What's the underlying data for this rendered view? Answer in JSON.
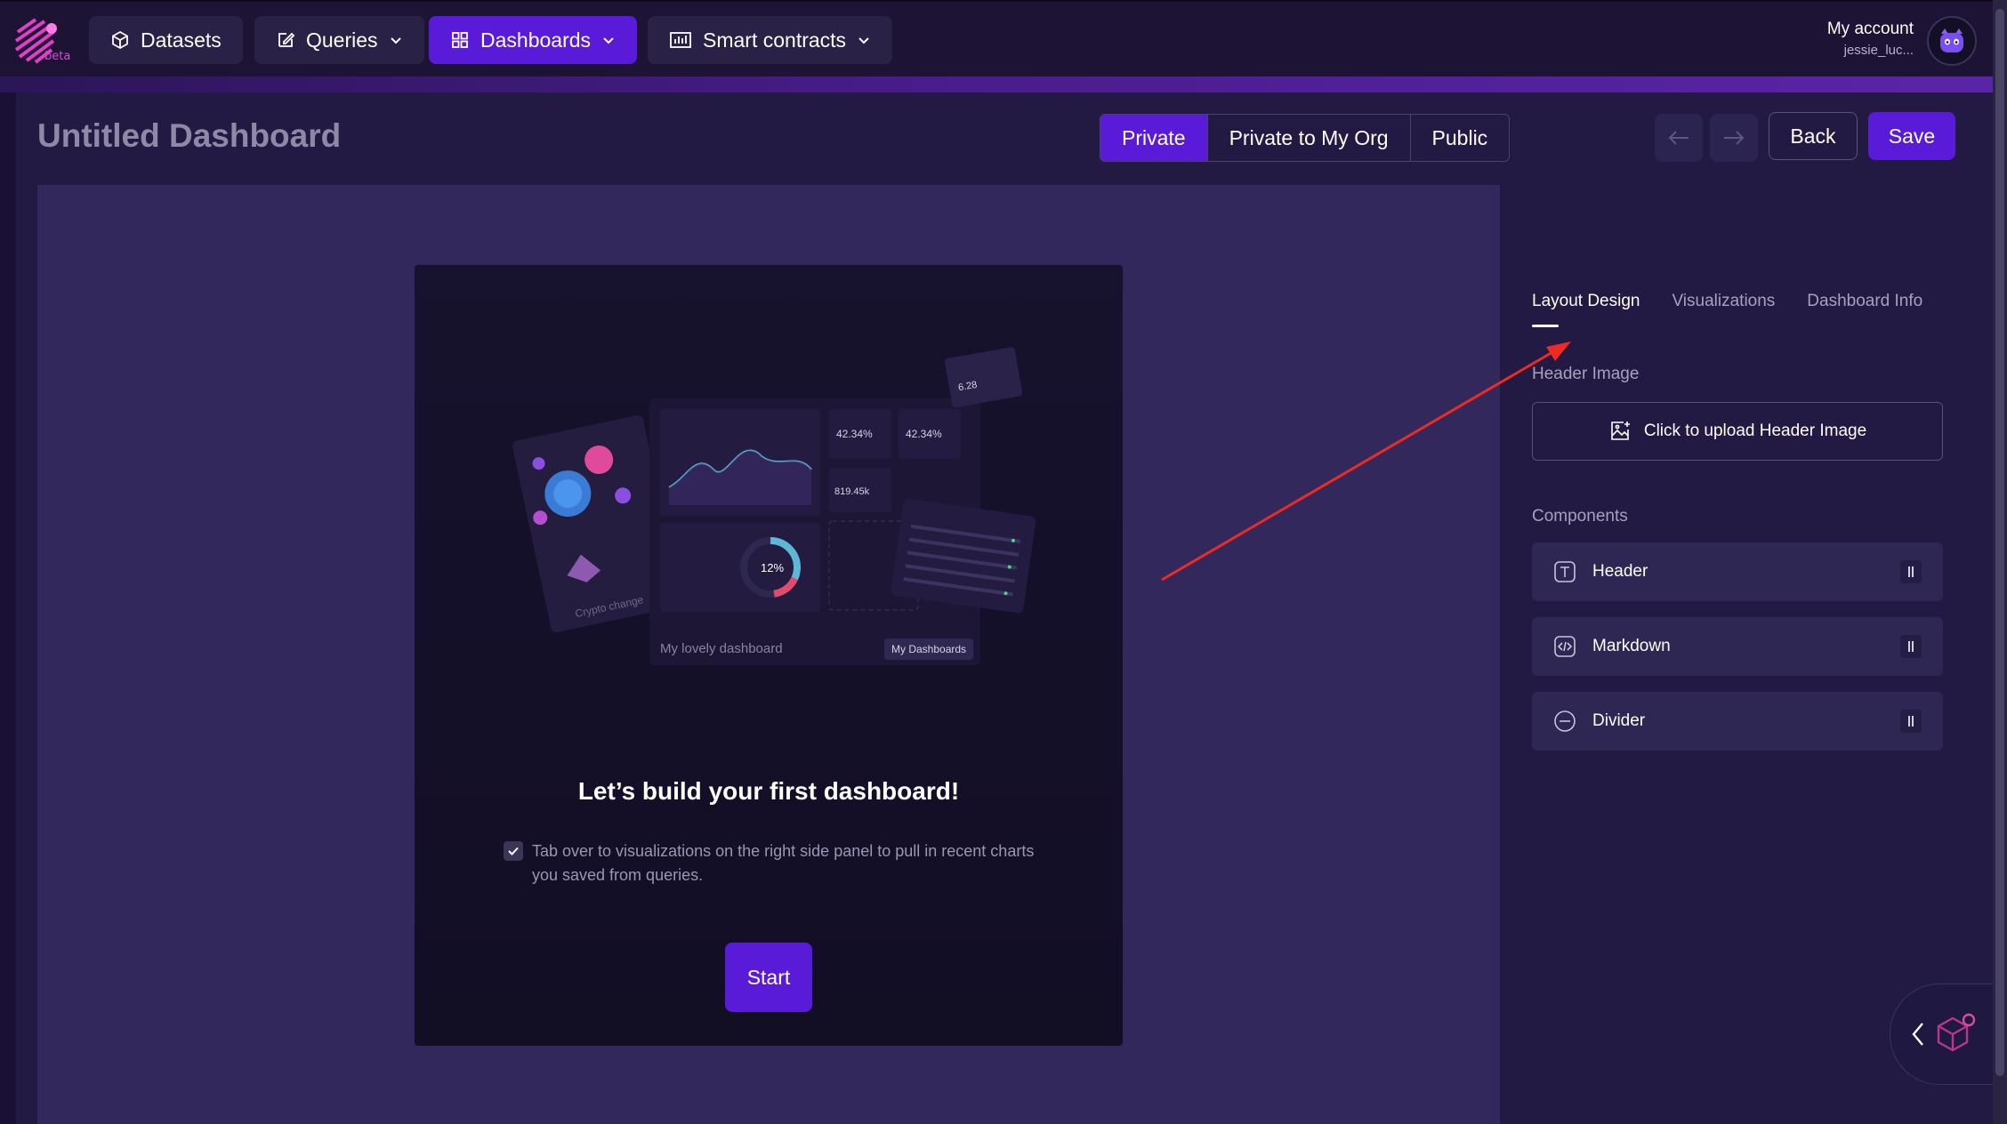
{
  "app": {
    "logo_text": "beta"
  },
  "nav": {
    "items": [
      {
        "label": "Datasets",
        "icon": "cube-icon"
      },
      {
        "label": "Queries",
        "icon": "edit-icon"
      },
      {
        "label": "Dashboards",
        "icon": "grid-icon"
      },
      {
        "label": "Smart contracts",
        "icon": "bar-chart-icon"
      }
    ]
  },
  "account": {
    "label": "My account",
    "username": "jessie_luc..."
  },
  "toolbar": {
    "title": "Untitled Dashboard",
    "visibility": [
      "Private",
      "Private to My Org",
      "Public"
    ],
    "visibility_selected": "Private",
    "back_label": "Back",
    "save_label": "Save"
  },
  "empty_state": {
    "title": "Let’s build your first dashboard!",
    "description": "Tab over to visualizations on the right side panel to pull in recent charts you saved from queries.",
    "start_label": "Start",
    "illustration": {
      "caption": "My lovely dashboard",
      "button": "My Dashboards",
      "percent": "12%",
      "side_card": "Crypto change"
    }
  },
  "panel": {
    "tabs": [
      "Layout Design",
      "Visualizations",
      "Dashboard Info"
    ],
    "active_tab": "Layout Design",
    "header_image_label": "Header Image",
    "upload_label": "Click to upload Header Image",
    "components_label": "Components",
    "components": [
      {
        "label": "Header",
        "icon": "text-icon"
      },
      {
        "label": "Markdown",
        "icon": "code-icon"
      },
      {
        "label": "Divider",
        "icon": "minus-icon"
      }
    ]
  },
  "colors": {
    "accent": "#5a1bd8",
    "background": "#221a43",
    "annotation": "#ee2a24"
  }
}
